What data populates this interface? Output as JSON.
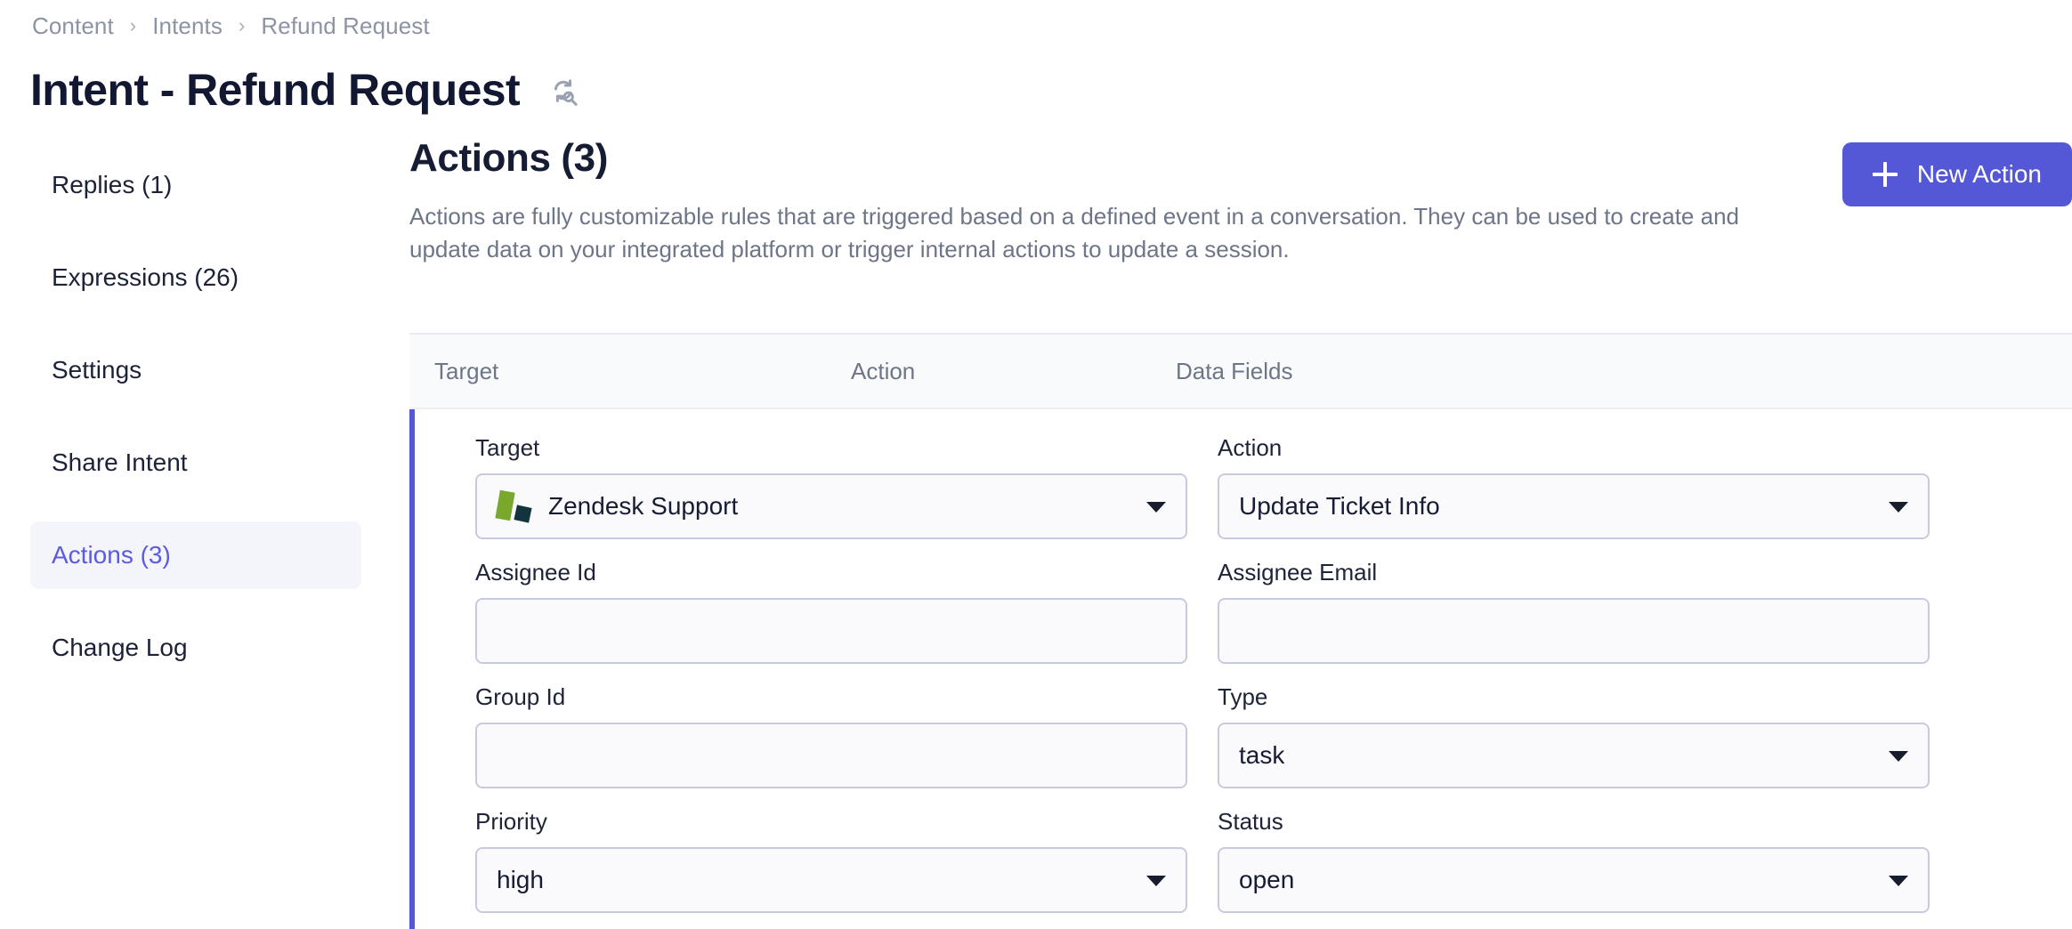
{
  "breadcrumb": {
    "items": [
      {
        "label": "Content"
      },
      {
        "label": "Intents"
      },
      {
        "label": "Refund Request"
      }
    ],
    "separator": "›"
  },
  "header": {
    "title": "Intent - Refund Request",
    "sync_icon": "sync-search-icon"
  },
  "sidebar": {
    "items": [
      {
        "label": "Replies (1)",
        "name": "replies",
        "active": false
      },
      {
        "label": "Expressions (26)",
        "name": "expressions",
        "active": false
      },
      {
        "label": "Settings",
        "name": "settings",
        "active": false
      },
      {
        "label": "Share Intent",
        "name": "share-intent",
        "active": false
      },
      {
        "label": "Actions (3)",
        "name": "actions",
        "active": true
      },
      {
        "label": "Change Log",
        "name": "change-log",
        "active": false
      }
    ],
    "active_color": "#5b5bdf",
    "active_background": "#f4f4fb"
  },
  "main": {
    "section_title": "Actions (3)",
    "section_description": "Actions are fully customizable rules that are triggered based on a defined event in a conversation. They can be used to create and update data on your integrated platform or trigger internal actions to update a session.",
    "new_action_label": "New Action",
    "new_action_color": "#5558d6",
    "accent_color": "#5558d6",
    "table_headers": {
      "target": "Target",
      "action": "Action",
      "data_fields": "Data Fields"
    },
    "action_row": {
      "target": {
        "label": "Target",
        "value": "Zendesk Support",
        "icon": "zendesk-logo-icon",
        "icon_colors": {
          "green": "#78a92d",
          "dark": "#13343c"
        }
      },
      "action": {
        "label": "Action",
        "value": "Update Ticket Info"
      },
      "assignee_id": {
        "label": "Assignee Id",
        "value": "",
        "placeholder": ""
      },
      "assignee_email": {
        "label": "Assignee Email",
        "value": "",
        "placeholder": ""
      },
      "group_id": {
        "label": "Group Id",
        "value": "",
        "placeholder": ""
      },
      "type": {
        "label": "Type",
        "value": "task"
      },
      "priority": {
        "label": "Priority",
        "value": "high"
      },
      "status": {
        "label": "Status",
        "value": "open"
      }
    }
  }
}
